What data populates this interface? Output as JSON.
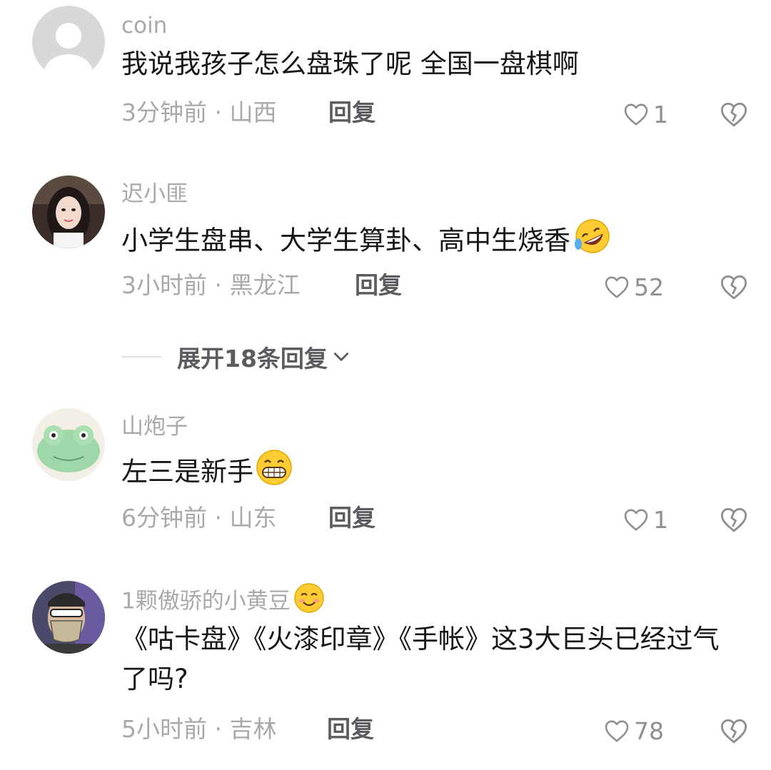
{
  "comments": [
    {
      "username": "coin",
      "text": "我说我孩子怎么盘珠了呢 全国一盘棋啊",
      "time_location": "3分钟前 · 山西",
      "reply_label": "回复",
      "likes": "1",
      "avatar": "default-avatar-icon"
    },
    {
      "username": "迟小匪",
      "text": "小学生盘串、大学生算卦、高中生烧香",
      "text_emoji": "rolling-on-floor-laughing-emoji",
      "time_location": "3小时前 · 黑龙江",
      "reply_label": "回复",
      "likes": "52",
      "avatar": "woman-photo-avatar"
    },
    {
      "username": "山炮子",
      "text": "左三是新手",
      "text_emoji": "grinning-emoji",
      "time_location": "6分钟前 · 山东",
      "reply_label": "回复",
      "likes": "1",
      "avatar": "frog-toy-avatar"
    },
    {
      "username": "1颗傲骄的小黄豆",
      "username_emoji": "smiling-face-emoji",
      "text": "《咕卡盘》《火漆印章》《手帐》这3大巨头已经过气了吗?",
      "time_location": "5小时前 · 吉林",
      "reply_label": "回复",
      "likes": "78",
      "avatar": "man-with-mask-avatar"
    }
  ],
  "expand_replies": {
    "label": "展开18条回复",
    "icon": "chevron-down-icon"
  },
  "colors": {
    "text_primary": "#17171a",
    "text_secondary": "#a9a9ad",
    "reply": "#5b5b60",
    "background": "#ffffff"
  }
}
